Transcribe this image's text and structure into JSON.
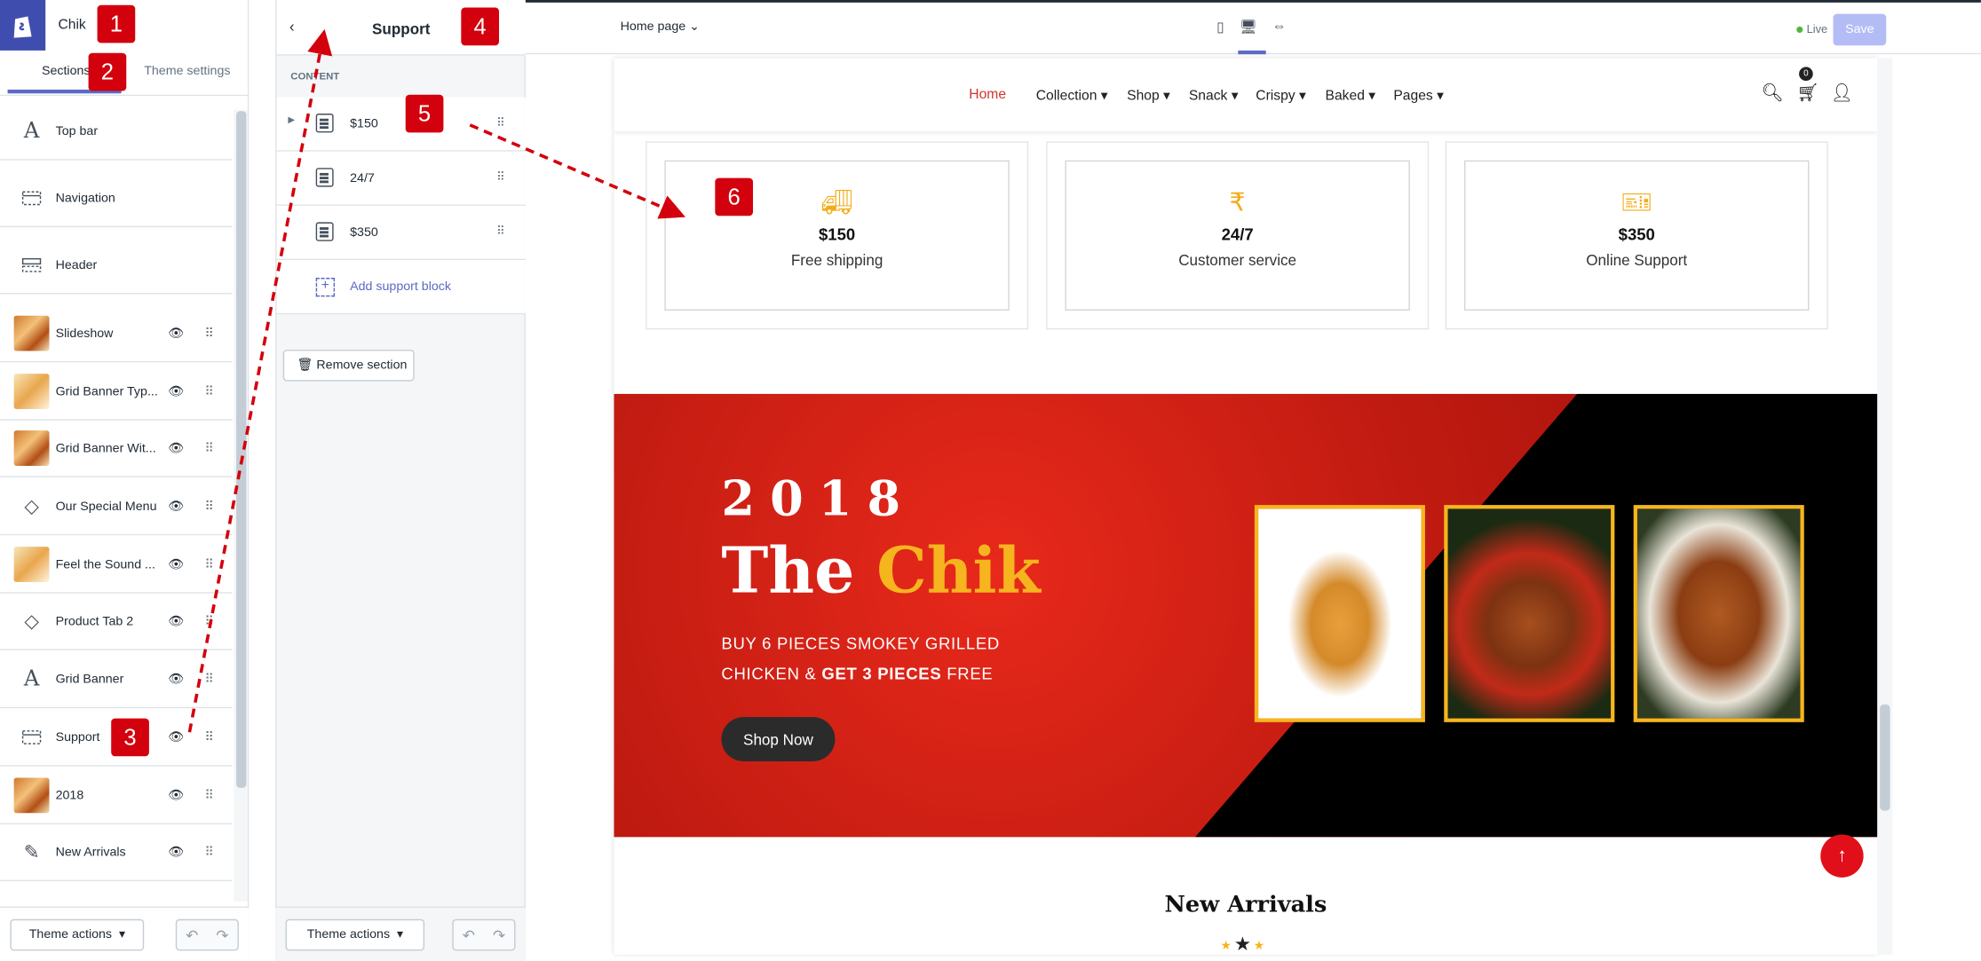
{
  "store": {
    "name": "Chik"
  },
  "tabs": {
    "sections": "Sections",
    "theme_settings": "Theme settings"
  },
  "sections": [
    {
      "label": "Top bar",
      "icon": "type-icon"
    },
    {
      "label": "Navigation",
      "icon": "nav-icon"
    },
    {
      "label": "Header",
      "icon": "header-icon"
    },
    {
      "label": "Slideshow",
      "icon": "image-thumb"
    },
    {
      "label": "Grid Banner Typ...",
      "icon": "image-thumb"
    },
    {
      "label": "Grid Banner Wit...",
      "icon": "image-thumb"
    },
    {
      "label": "Our Special Menu",
      "icon": "tag-icon"
    },
    {
      "label": "Feel the Sound ...",
      "icon": "image-thumb"
    },
    {
      "label": "Product Tab 2",
      "icon": "tag-icon"
    },
    {
      "label": "Grid Banner",
      "icon": "type-icon"
    },
    {
      "label": "Support",
      "icon": "nav-icon"
    },
    {
      "label": "2018",
      "icon": "image-thumb"
    },
    {
      "label": "New Arrivals",
      "icon": "edit-icon"
    }
  ],
  "footer": {
    "theme_actions": "Theme actions"
  },
  "support_panel": {
    "title": "Support",
    "content_label": "CONTENT",
    "blocks": [
      "$150",
      "24/7",
      "$350"
    ],
    "add_block": "Add support block",
    "remove": "Remove section"
  },
  "topbar": {
    "page": "Home page",
    "live": "Live",
    "save": "Save"
  },
  "preview": {
    "nav": [
      "Home",
      "Collection",
      "Shop",
      "Snack",
      "Crispy",
      "Baked",
      "Pages"
    ],
    "cart_count": "0",
    "support": [
      {
        "value": "$150",
        "text": "Free shipping",
        "icon": "truck-icon"
      },
      {
        "value": "24/7",
        "text": "Customer service",
        "icon": "rupee-icon"
      },
      {
        "value": "$350",
        "text": "Online Support",
        "icon": "ticket-icon"
      }
    ],
    "banner": {
      "year": "2018",
      "title_a": "The",
      "title_b": "Chik",
      "line1": "BUY 6 PIECES SMOKEY GRILLED",
      "line2_a": "CHICKEN & ",
      "line2_b": "GET 3 PIECES",
      "line2_c": " FREE",
      "button": "Shop Now"
    },
    "new_arrivals": "New Arrivals"
  },
  "annotations": [
    "1",
    "2",
    "3",
    "4",
    "5",
    "6"
  ],
  "colors": {
    "accent": "#5c6ac4",
    "badge": "#d3000d",
    "brand_yellow": "#f6b51e",
    "banner_red": "#c11b11"
  }
}
